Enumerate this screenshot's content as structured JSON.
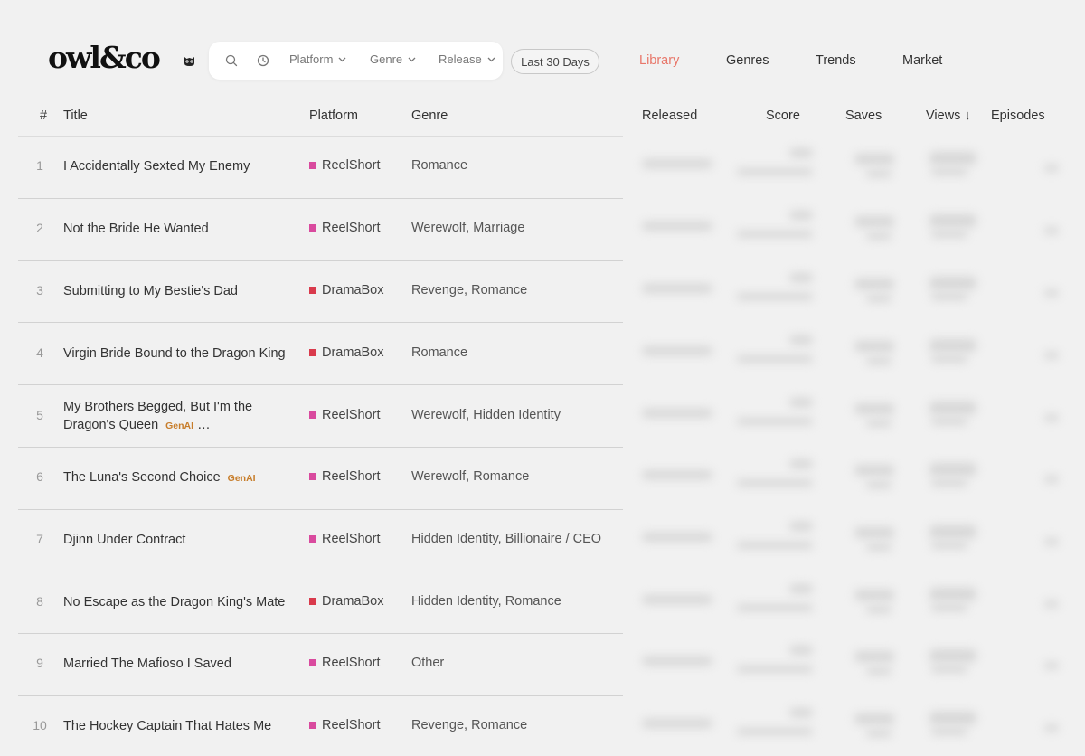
{
  "brand": {
    "logo_text": "owl&co",
    "icon": "owl-icon"
  },
  "filters": {
    "search_icon": "search-icon",
    "clock_icon": "clock-icon",
    "platform_label": "Platform",
    "genre_label": "Genre",
    "release_label": "Release",
    "date_range": "Last 30 Days"
  },
  "nav": {
    "items": [
      {
        "label": "Library",
        "active": true
      },
      {
        "label": "Genres",
        "active": false
      },
      {
        "label": "Trends",
        "active": false
      },
      {
        "label": "Market",
        "active": false
      }
    ]
  },
  "colors": {
    "accent": "#e8776a",
    "reelshort": "#d94a9e",
    "dramabox": "#d93a4c",
    "genai": "#c77d2a"
  },
  "table": {
    "columns": {
      "num": "#",
      "title": "Title",
      "platform": "Platform",
      "genre": "Genre",
      "released": "Released",
      "score": "Score",
      "saves": "Saves",
      "views": "Views ↓",
      "episodes": "Episodes"
    },
    "rows": [
      {
        "num": "1",
        "title": "I Accidentally Sexted My Enemy",
        "genai": "",
        "ellipsis": "",
        "platform": "ReelShort",
        "genre": "Romance"
      },
      {
        "num": "2",
        "title": "Not the Bride He Wanted",
        "genai": "",
        "ellipsis": "",
        "platform": "ReelShort",
        "genre": "Werewolf, Marriage"
      },
      {
        "num": "3",
        "title": "Submitting to My Bestie's Dad",
        "genai": "",
        "ellipsis": "",
        "platform": "DramaBox",
        "genre": "Revenge, Romance"
      },
      {
        "num": "4",
        "title": "Virgin Bride Bound to the Dragon King",
        "genai": "",
        "ellipsis": "",
        "platform": "DramaBox",
        "genre": "Romance"
      },
      {
        "num": "5",
        "title": "My Brothers Begged, But I'm the Dragon's Queen",
        "genai": "GenAI",
        "ellipsis": "…",
        "platform": "ReelShort",
        "genre": "Werewolf, Hidden Identity"
      },
      {
        "num": "6",
        "title": "The Luna's Second Choice",
        "genai": "GenAI",
        "ellipsis": "",
        "platform": "ReelShort",
        "genre": "Werewolf, Romance"
      },
      {
        "num": "7",
        "title": "Djinn Under Contract",
        "genai": "",
        "ellipsis": "",
        "platform": "ReelShort",
        "genre": "Hidden Identity, Billionaire / CEO"
      },
      {
        "num": "8",
        "title": "No Escape as the Dragon King's Mate",
        "genai": "",
        "ellipsis": "",
        "platform": "DramaBox",
        "genre": "Hidden Identity, Romance"
      },
      {
        "num": "9",
        "title": "Married The Mafioso I Saved",
        "genai": "",
        "ellipsis": "",
        "platform": "ReelShort",
        "genre": "Other"
      },
      {
        "num": "10",
        "title": "The Hockey Captain That Hates Me",
        "genai": "",
        "ellipsis": "",
        "platform": "ReelShort",
        "genre": "Revenge, Romance"
      }
    ]
  }
}
